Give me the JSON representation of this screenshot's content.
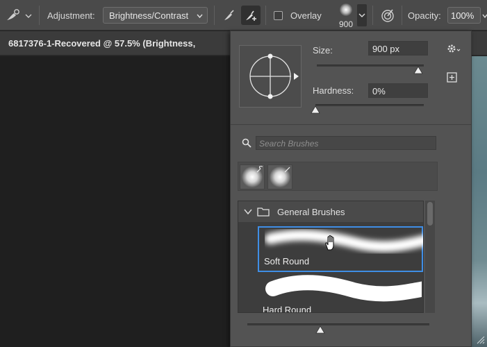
{
  "options_bar": {
    "tool_icon": "brush-adjustment-icon",
    "adjustment_label": "Adjustment:",
    "adjustment_value": "Brightness/Contrast",
    "brush_modes": [
      "brush-icon",
      "brush-plus-icon"
    ],
    "overlay_label": "Overlay",
    "overlay_checked": false,
    "brush_size": "900",
    "opacity_label": "Opacity:",
    "opacity_value": "100%"
  },
  "document": {
    "tab_title": "6817376-1-Recovered @ 57.5% (Brightness,"
  },
  "brush_panel": {
    "size_label": "Size:",
    "size_value": "900 px",
    "size_fraction": 0.95,
    "hardness_label": "Hardness:",
    "hardness_value": "0%",
    "hardness_fraction": 0.0,
    "search_placeholder": "Search Brushes",
    "recent_brushes": [
      "soft-round",
      "soft-round"
    ],
    "group_name": "General Brushes",
    "brushes": [
      {
        "label": "Soft Round",
        "selected": true
      },
      {
        "label": "Hard Round",
        "selected": false
      }
    ],
    "preview_size_fraction": 0.4
  },
  "colors": {
    "accent": "#3f8ee6",
    "panel_bg": "#535353",
    "canvas_bg": "#1f1f1f"
  }
}
